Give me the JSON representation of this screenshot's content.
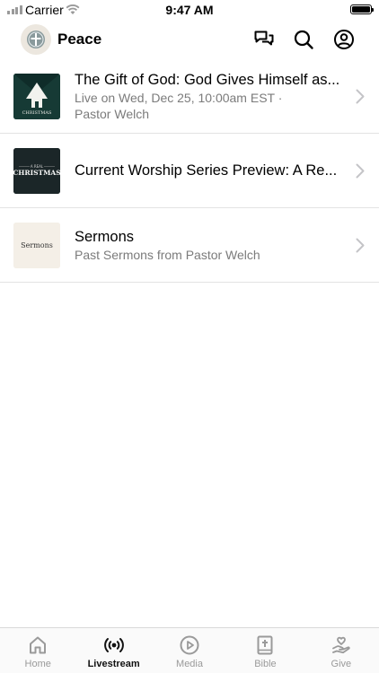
{
  "status_bar": {
    "carrier": "Carrier",
    "time": "9:47 AM"
  },
  "header": {
    "title": "Peace"
  },
  "feed": [
    {
      "title": "The Gift of God: God Gives Himself as...",
      "subtitle_line1": "Live on Wed, Dec 25, 10:00am EST ·",
      "subtitle_line2": "Pastor Welch",
      "thumb_caption": "CHRISTMAS"
    },
    {
      "title": "Current Worship Series Preview: A Re...",
      "thumb_top": "A REAL",
      "thumb_caption": "CHRISTMAS"
    },
    {
      "title": "Sermons",
      "subtitle_line1": "Past Sermons from Pastor Welch",
      "thumb_caption": "Sermons"
    }
  ],
  "tabs": [
    {
      "label": "Home",
      "icon": "home-icon",
      "active": false
    },
    {
      "label": "Livestream",
      "icon": "broadcast-icon",
      "active": true
    },
    {
      "label": "Media",
      "icon": "play-circle-icon",
      "active": false
    },
    {
      "label": "Bible",
      "icon": "bible-icon",
      "active": false
    },
    {
      "label": "Give",
      "icon": "give-hand-icon",
      "active": false
    }
  ],
  "colors": {
    "accent": "#111111",
    "inactive": "#9a9a9a",
    "separator": "#e3e3e3"
  }
}
